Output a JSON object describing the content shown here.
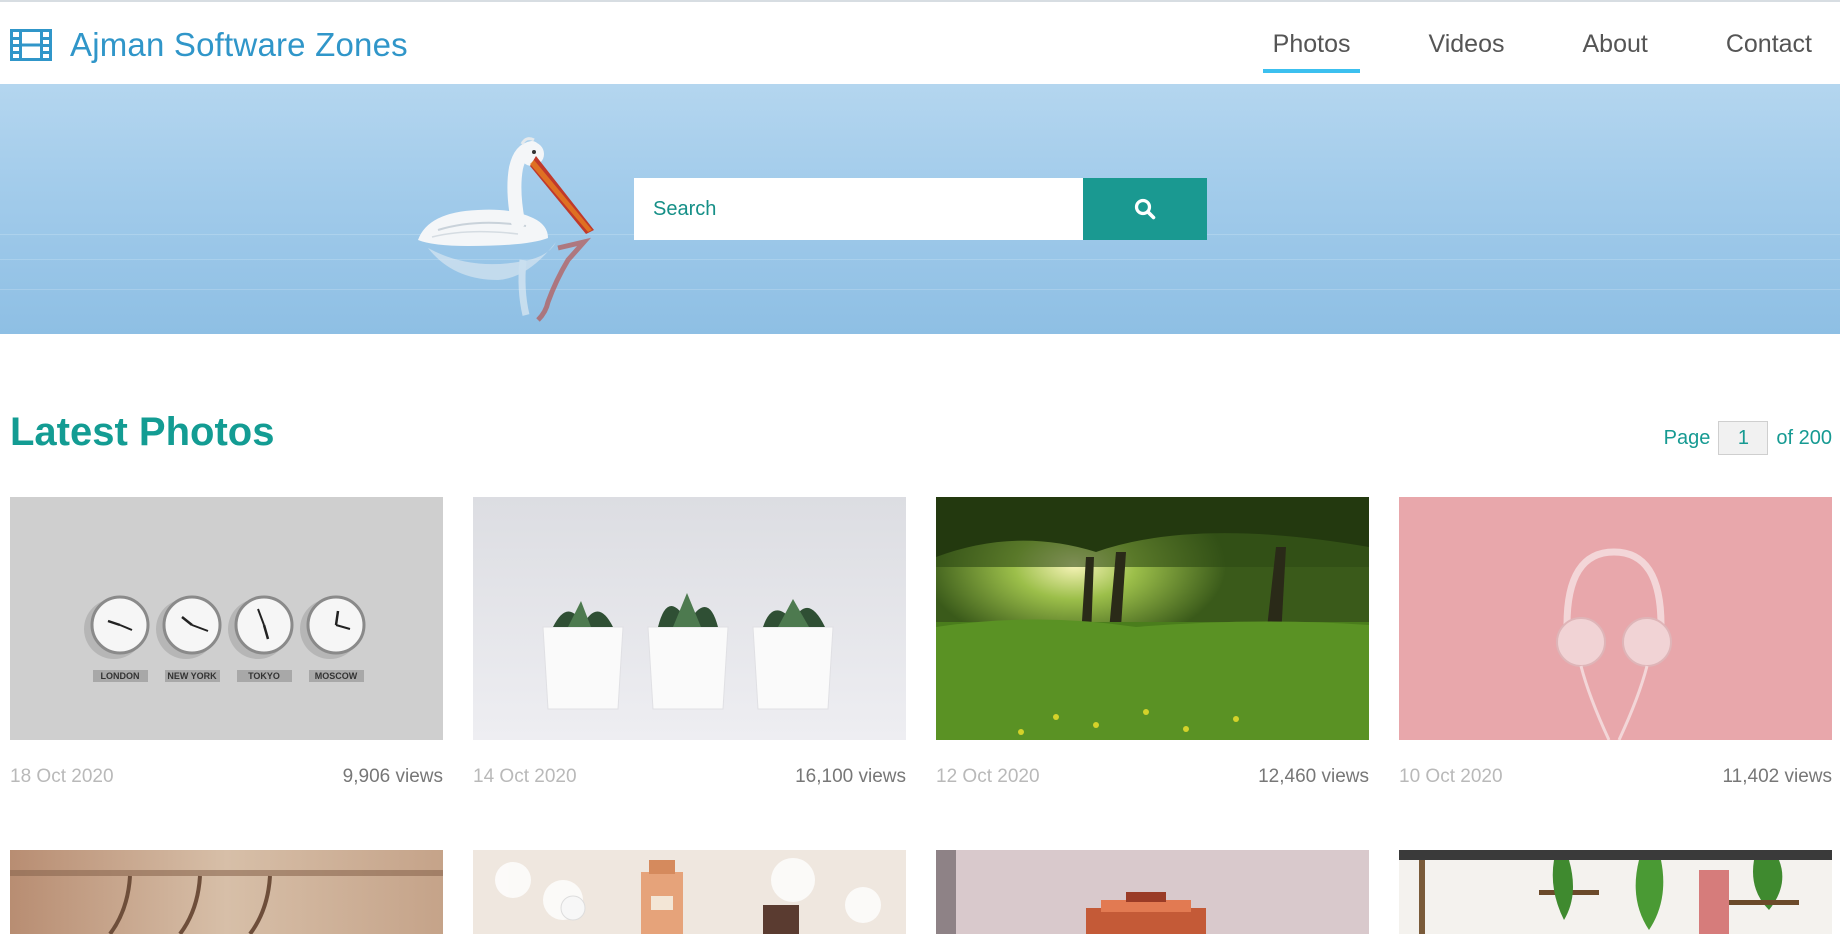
{
  "brand": {
    "name": "Ajman Software Zones",
    "icon": "film-icon",
    "color": "#3096c9"
  },
  "nav": {
    "items": [
      {
        "label": "Photos",
        "active": true
      },
      {
        "label": "Videos",
        "active": false
      },
      {
        "label": "About",
        "active": false
      },
      {
        "label": "Contact",
        "active": false
      }
    ]
  },
  "hero": {
    "search": {
      "placeholder": "Search",
      "button_icon": "search-icon"
    }
  },
  "section": {
    "title": "Latest Photos",
    "pager": {
      "prefix": "Page",
      "current": "1",
      "suffix": "of 200"
    }
  },
  "photos": [
    {
      "date": "18 Oct 2020",
      "views": "9,906 views",
      "subject": "wall-clocks",
      "labels": [
        "LONDON",
        "NEW YORK",
        "TOKYO",
        "MOSCOW"
      ]
    },
    {
      "date": "14 Oct 2020",
      "views": "16,100 views",
      "subject": "potted-succulents"
    },
    {
      "date": "12 Oct 2020",
      "views": "12,460 views",
      "subject": "forest-meadow"
    },
    {
      "date": "10 Oct 2020",
      "views": "11,402 views",
      "subject": "headphones-pink"
    }
  ],
  "photos_row2": [
    {
      "subject": "hangers"
    },
    {
      "subject": "perfume-fur"
    },
    {
      "subject": "toy-car"
    },
    {
      "subject": "plants-interior"
    }
  ],
  "colors": {
    "accent": "#1a9991",
    "title": "#139c93",
    "nav_underline": "#3cc0ef"
  }
}
